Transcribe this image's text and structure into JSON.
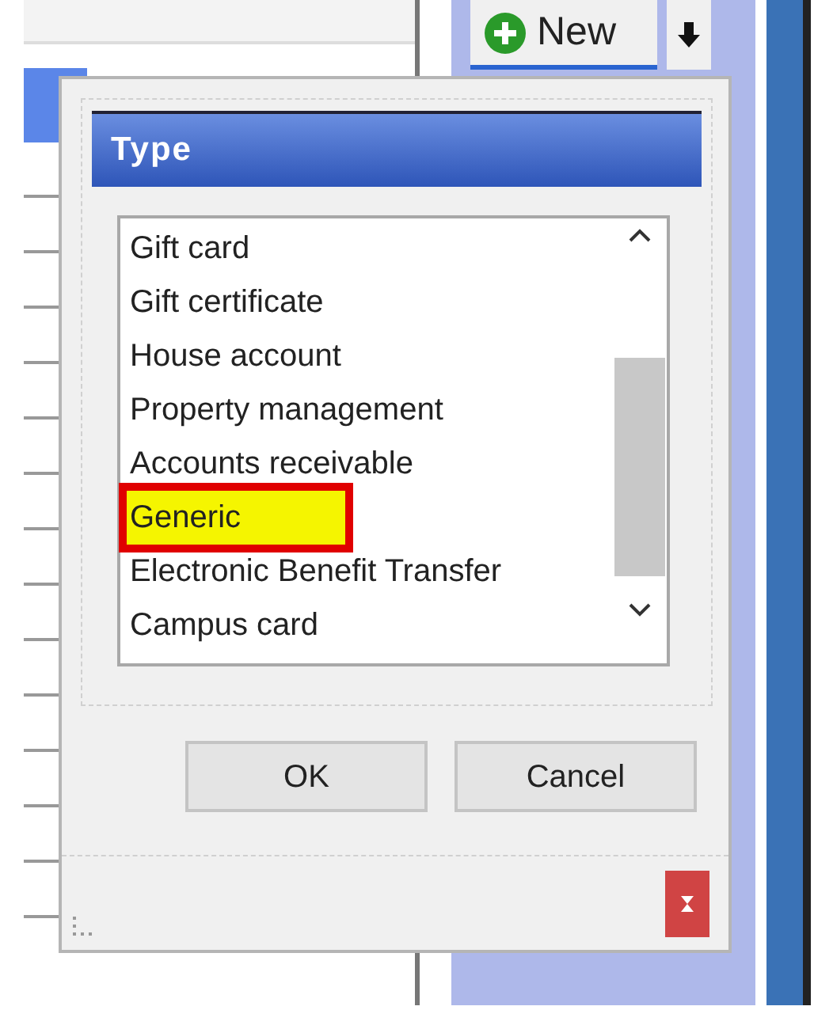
{
  "toolbar": {
    "new_button": "New"
  },
  "dialog": {
    "title": "Type",
    "items": [
      {
        "label": "Gift card",
        "selected": false
      },
      {
        "label": "Gift certificate",
        "selected": false
      },
      {
        "label": "House account",
        "selected": false
      },
      {
        "label": "Property management",
        "selected": false
      },
      {
        "label": "Accounts receivable",
        "selected": false
      },
      {
        "label": "Generic",
        "selected": true
      },
      {
        "label": "Electronic Benefit Transfer",
        "selected": false
      },
      {
        "label": "Campus card",
        "selected": false
      }
    ],
    "buttons": [
      "OK",
      "Cancel"
    ]
  }
}
